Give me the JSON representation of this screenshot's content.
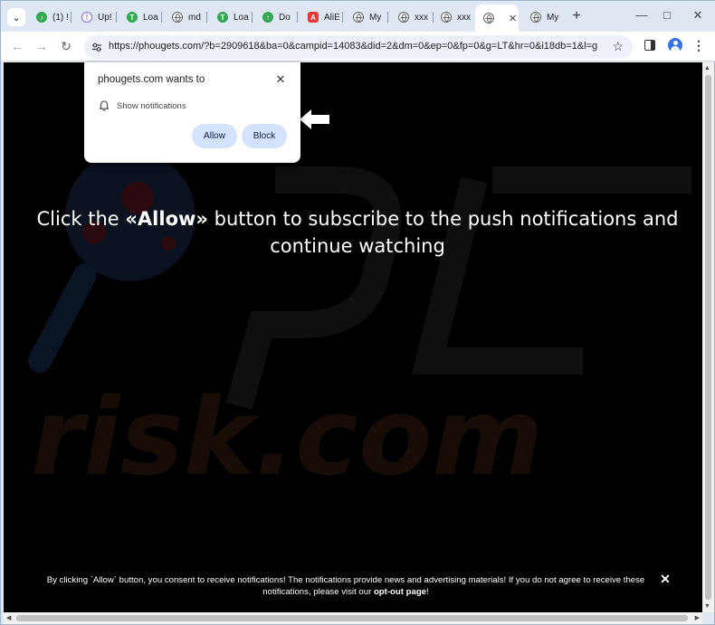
{
  "tabs": [
    {
      "label": "(1) !",
      "icon": "tiktok-icon",
      "color": "#34a853"
    },
    {
      "label": "Up!",
      "icon": "info-circle-icon",
      "color": "#7c6cf0"
    },
    {
      "label": "Loa",
      "icon": "t-logo-icon",
      "color": "#34a853"
    },
    {
      "label": "md",
      "icon": "globe-icon",
      "color": "#5f6368"
    },
    {
      "label": "Loa",
      "icon": "t-logo-icon",
      "color": "#34a853"
    },
    {
      "label": "Do",
      "icon": "upload-icon",
      "color": "#34a853"
    },
    {
      "label": "AliE",
      "icon": "aliexpress-icon",
      "color": "#e53935"
    },
    {
      "label": "My",
      "icon": "globe-icon",
      "color": "#5f6368"
    },
    {
      "label": "xxx",
      "icon": "globe-icon",
      "color": "#5f6368"
    },
    {
      "label": "xxx",
      "icon": "globe-icon",
      "color": "#5f6368"
    },
    {
      "label": "",
      "icon": "globe-icon",
      "color": "#5f6368",
      "active": true
    },
    {
      "label": "My",
      "icon": "globe-icon",
      "color": "#5f6368"
    }
  ],
  "toolbar": {
    "url": "https://phougets.com/?b=2909618&ba=0&campid=14083&did=2&dm=0&ep=0&fp=0&g=LT&hr=0&i18db=1&l=g..."
  },
  "prompt": {
    "title": "phougets.com wants to",
    "permission": "Show notifications",
    "allow_label": "Allow",
    "block_label": "Block"
  },
  "page": {
    "headline_pre": "Click the ",
    "headline_bold": "«Allow»",
    "headline_post": " button to subscribe to the push notifications and continue watching",
    "footer_text": "By clicking `Allow` button, you consent to receive notifications! The notifications provide news and advertising materials! If you do not agree to receive these notifications, please visit our ",
    "footer_link": "opt-out page",
    "footer_end": "!",
    "watermark": "risk.com"
  },
  "colors": {
    "page_background": "#000000",
    "button_fill": "#d3e3fd",
    "frame": "#dfe7f3"
  }
}
